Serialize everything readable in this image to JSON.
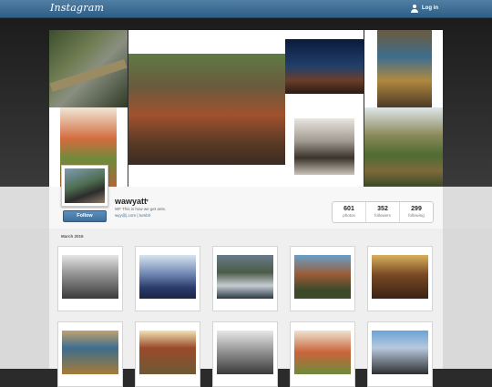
{
  "header": {
    "logo_text": "Instagram",
    "login_label": "Log in"
  },
  "profile": {
    "username": "wawyatt",
    "bio": "WF This is how we get ants.",
    "links": [
      "wyy@j.com",
      "tumblr"
    ],
    "link_separator": "|",
    "follow_label": "Follow",
    "stats": [
      {
        "value": "601",
        "label": "photos"
      },
      {
        "value": "352",
        "label": "followers"
      },
      {
        "value": "299",
        "label": "following"
      }
    ]
  },
  "gallery": {
    "month_label": "March 2015",
    "photo_count_visible": 10
  },
  "colors": {
    "topbar": "#3f6f9c",
    "follow_button": "#4a7fae",
    "link_color": "#3f729b"
  }
}
